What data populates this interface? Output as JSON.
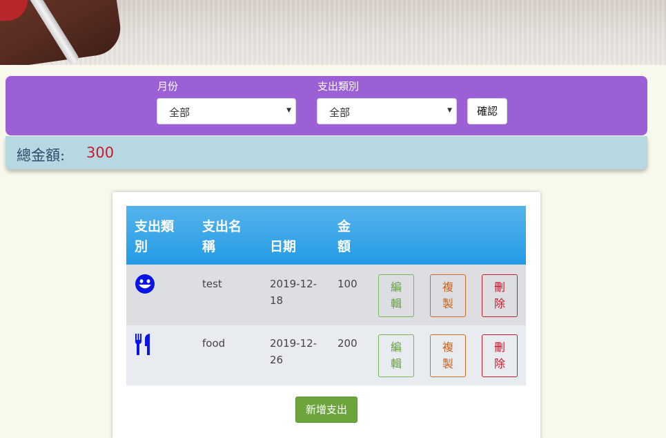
{
  "filters": {
    "month_label": "月份",
    "month_value": "全部",
    "category_label": "支出類別",
    "category_value": "全部",
    "confirm_label": "確認"
  },
  "total": {
    "label": "總金額:",
    "value": "300"
  },
  "table": {
    "headers": {
      "category": [
        "支出類",
        "別"
      ],
      "name": [
        "支出名",
        "稱"
      ],
      "date": "日期",
      "amount": [
        "金",
        "額"
      ]
    },
    "rows": [
      {
        "icon": "smile-icon",
        "name": "test",
        "date": [
          "2019-12-",
          "18"
        ],
        "amount": "100"
      },
      {
        "icon": "utensils-icon",
        "name": "food",
        "date": [
          "2019-12-",
          "26"
        ],
        "amount": "200"
      }
    ],
    "actions": {
      "edit": [
        "編",
        "輯"
      ],
      "copy": [
        "複",
        "製"
      ],
      "delete": [
        "刪",
        "除"
      ]
    }
  },
  "add_button_label": "新增支出",
  "colors": {
    "filter_bar": "#9b5fd6",
    "total_bar": "#b7d8e3",
    "total_value": "#c8192a",
    "header_blue": "#239be6",
    "icon_blue": "#0a14e6",
    "edit": "#6a9f48",
    "copy": "#c8631c",
    "delete": "#c8192a",
    "add_button": "#6ba53b"
  }
}
